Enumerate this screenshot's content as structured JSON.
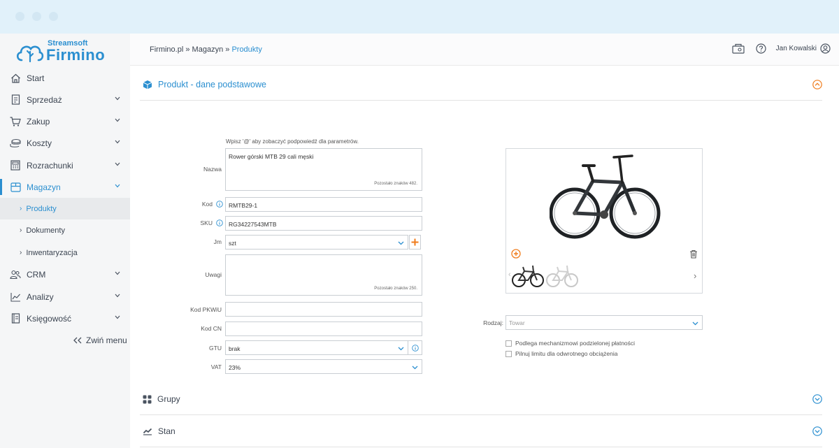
{
  "app": {
    "brand_small": "Streamsoft",
    "brand_big": "Firmino"
  },
  "sidebar": {
    "items": [
      {
        "label": "Start",
        "icon": "home-icon"
      },
      {
        "label": "Sprzedaż",
        "icon": "receipt-icon"
      },
      {
        "label": "Zakup",
        "icon": "cart-icon"
      },
      {
        "label": "Koszty",
        "icon": "coins-icon"
      },
      {
        "label": "Rozrachunki",
        "icon": "calculator-icon"
      },
      {
        "label": "Magazyn",
        "icon": "warehouse-icon"
      },
      {
        "label": "CRM",
        "icon": "users-icon"
      },
      {
        "label": "Analizy",
        "icon": "chart-line-icon"
      },
      {
        "label": "Księgowość",
        "icon": "ledger-icon"
      }
    ],
    "sub_items": [
      {
        "label": "Produkty"
      },
      {
        "label": "Dokumenty"
      },
      {
        "label": "Inwentaryzacja"
      }
    ],
    "collapse_label": "Zwiń menu"
  },
  "header": {
    "breadcrumb": [
      "Firmino.pl",
      "Magazyn",
      "Produkty"
    ],
    "separator": "»",
    "user_name": "Jan Kowalski"
  },
  "sections": {
    "main_title": "Produkt - dane podstawowe",
    "groups_title": "Grupy",
    "stock_title": "Stan"
  },
  "form": {
    "hint": "Wpisz '@' aby zobaczyć podpowiedź dla parametrów.",
    "nazwa_label": "Nazwa",
    "nazwa_value": "Rower górski MTB 29 cali męski",
    "nazwa_counter": "Pozostało znaków 482.",
    "kod_label": "Kod",
    "kod_value": "RMTB29-1",
    "sku_label": "SKU",
    "sku_value": "RG34227543MTB",
    "jm_label": "Jm",
    "jm_value": "szt",
    "uwagi_label": "Uwagi",
    "uwagi_value": "",
    "uwagi_counter": "Pozostało znaków 250.",
    "pkwiu_label": "Kod PKWiU",
    "pkwiu_value": "",
    "cn_label": "Kod CN",
    "cn_value": "",
    "gtu_label": "GTU",
    "gtu_value": "brak",
    "vat_label": "VAT",
    "vat_value": "23%",
    "rodzaj_label": "Rodzaj",
    "rodzaj_value": "Towar",
    "checkbox1": "Podlega mechanizmowi podzielonej płatności",
    "checkbox2": "Pilnuj limitu dla odwrotnego obciążenia"
  },
  "colors": {
    "accent": "#2b8fd0",
    "orange": "#f07c1c"
  }
}
